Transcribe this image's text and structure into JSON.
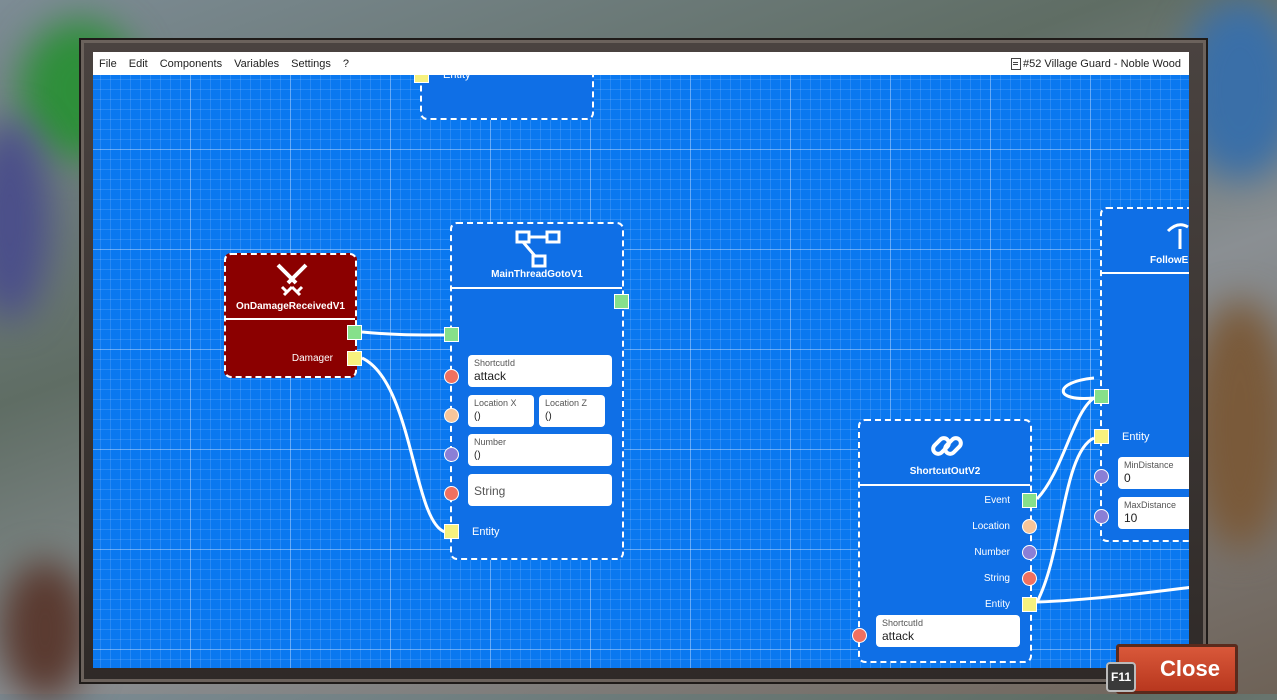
{
  "menu": {
    "items": [
      "File",
      "Edit",
      "Components",
      "Variables",
      "Settings",
      "?"
    ],
    "title": "#52 Village Guard - Noble Wood"
  },
  "nodes": {
    "top_partial": {
      "port_label": "Entity"
    },
    "on_damage": {
      "title": "OnDamageReceivedV1",
      "output_label": "Damager",
      "icon": "crossed-swords-icon"
    },
    "goto": {
      "title": "MainThreadGotoV1",
      "icon": "flow-branch-icon",
      "shortcut_label": "ShortcutId",
      "shortcut_value": "attack",
      "loc_x_label": "Location X",
      "loc_x_value": "()",
      "loc_z_label": "Location Z",
      "loc_z_value": "()",
      "number_label": "Number",
      "number_value": "()",
      "string_value": "String",
      "entity_label": "Entity"
    },
    "shortcut_out": {
      "title": "ShortcutOutV2",
      "icon": "link-chain-icon",
      "outputs": [
        "Event",
        "Location",
        "Number",
        "String",
        "Entity"
      ],
      "shortcut_label": "ShortcutId",
      "shortcut_value": "attack"
    },
    "follow": {
      "title": "FollowE",
      "icon": "follow-icon",
      "entity_label": "Entity",
      "min_label": "MinDistance",
      "min_value": "0",
      "max_label": "MaxDistance",
      "max_value": "10"
    }
  },
  "buttons": {
    "close": "Close",
    "close_key": "F11"
  }
}
